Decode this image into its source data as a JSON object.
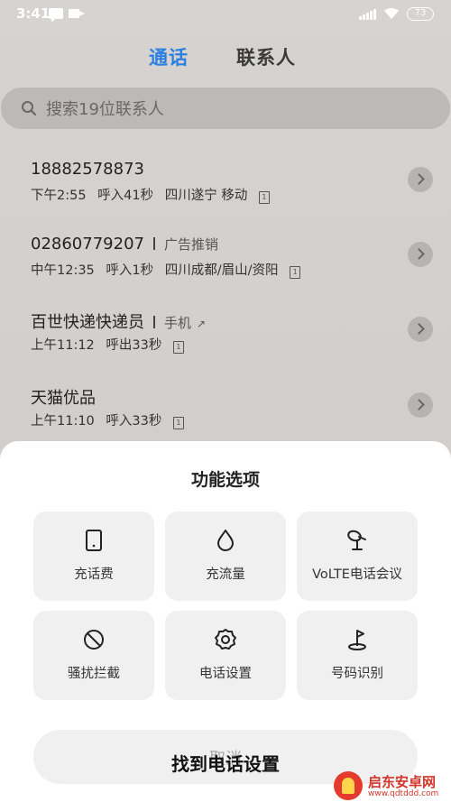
{
  "status_bar": {
    "time": "3:41",
    "battery": "73"
  },
  "tabs": [
    {
      "label": "通话",
      "active": true
    },
    {
      "label": "联系人",
      "active": false
    }
  ],
  "search": {
    "placeholder": "搜索19位联系人"
  },
  "calls": [
    {
      "name": "18882578873",
      "tag": "",
      "time": "下午2:55",
      "detail": "呼入41秒",
      "location": "四川遂宁 移动",
      "sim": "1"
    },
    {
      "name": "02860779207",
      "tag": "广告推销",
      "time": "中午12:35",
      "detail": "呼入1秒",
      "location": "四川成都/眉山/资阳",
      "sim": "1"
    },
    {
      "name": "百世快递快递员",
      "tag": "手机",
      "time": "上午11:12",
      "detail": "呼出33秒",
      "location": "",
      "sim": "1"
    },
    {
      "name": "天猫优品",
      "tag": "",
      "time": "上午11:10",
      "detail": "呼入33秒",
      "location": "",
      "sim": "1"
    }
  ],
  "sheet": {
    "title": "功能选项",
    "options": [
      {
        "label": "充话费",
        "icon": "tablet-icon"
      },
      {
        "label": "充流量",
        "icon": "droplet-icon"
      },
      {
        "label": "VoLTE电话会议",
        "icon": "satellite-icon"
      },
      {
        "label": "骚扰拦截",
        "icon": "block-icon"
      },
      {
        "label": "电话设置",
        "icon": "gear-icon"
      },
      {
        "label": "号码识别",
        "icon": "flag-icon"
      }
    ],
    "cancel_label": "取消"
  },
  "caption": "找到电话设置",
  "watermark": {
    "name": "启东安卓网",
    "url": "www.qdtddd.com"
  },
  "colors": {
    "accent": "#2a7fe0",
    "sheet_bg": "#ffffff",
    "tile_bg": "#f0f0f0"
  }
}
